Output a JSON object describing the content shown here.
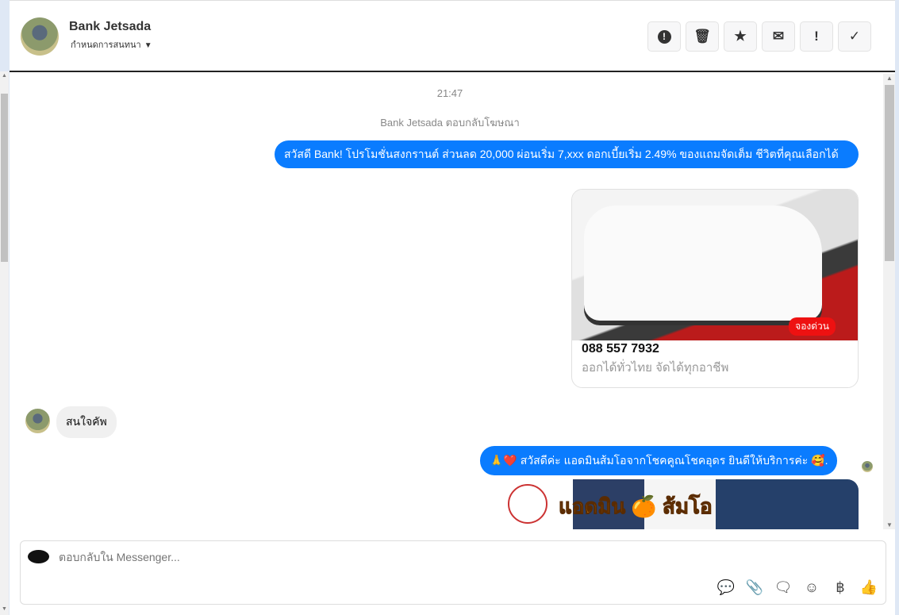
{
  "header": {
    "name": "Bank Jetsada",
    "subtitle": "กำหนดการสนทนา",
    "caret": "▼",
    "actions": [
      {
        "name": "report",
        "icon": "!"
      },
      {
        "name": "delete",
        "icon": "🗑"
      },
      {
        "name": "star",
        "icon": "★"
      },
      {
        "name": "mail",
        "icon": "✉"
      },
      {
        "name": "important",
        "icon": "!"
      },
      {
        "name": "done",
        "icon": "✓"
      }
    ]
  },
  "messages": {
    "time": "21:47",
    "reply_note": "Bank Jetsada ตอบกลับโฆษณา",
    "out1": "สวัสดี Bank! โปรโมชั่นสงกรานต์ ส่วนลด 20,000 ผ่อนเริ่ม 7,xxx ดอกเบี้ยเริ่ม 2.49% ของแถมจัดเต็ม ชีวิตที่คุณเลือกได้",
    "card": {
      "badge": "จองด่วน",
      "title": "088 557 7932",
      "subtitle": "ออกได้ทั่วไทย จัดได้ทุกอาชีพ"
    },
    "in1": "สนใจคัพ",
    "out2": "🙏❤️ สวัสดีค่ะ แอดมินส้มโอจากโชคคูณโชคอุดร ยินดีให้บริการค่ะ 🥰.",
    "promo_text": "แอดมิน 🍊 ส้มโอ"
  },
  "composer": {
    "placeholder": "ตอบกลับใน Messenger..."
  }
}
